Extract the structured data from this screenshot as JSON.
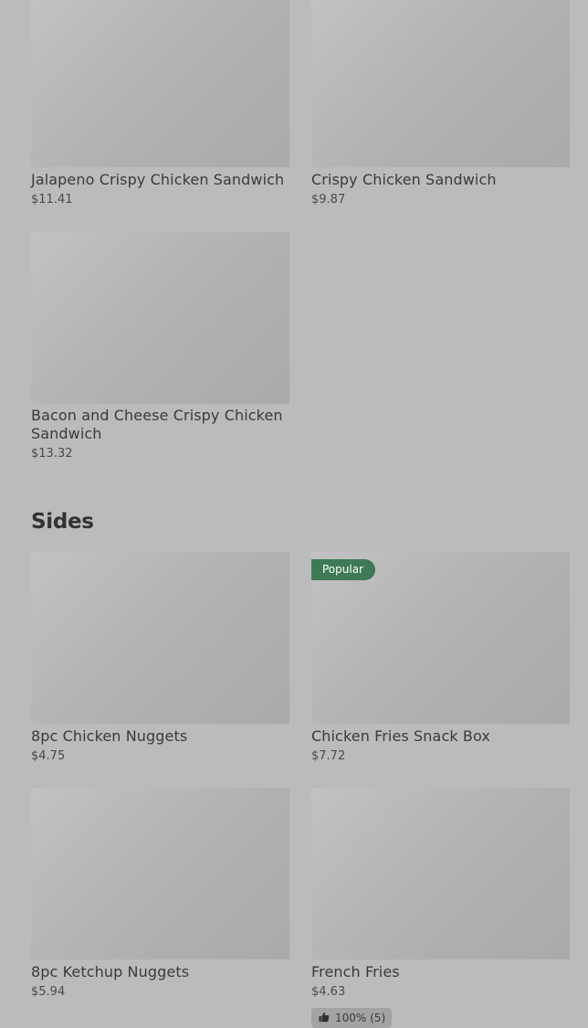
{
  "products": [
    {
      "name": "Jalapeno Crispy Chicken Sandwich",
      "price": "$11.41"
    },
    {
      "name": "Crispy Chicken Sandwich",
      "price": "$9.87"
    },
    {
      "name": "Bacon and Cheese Crispy Chicken Sandwich",
      "price": "$13.32"
    }
  ],
  "sides": {
    "title": "Sides",
    "items": [
      {
        "name": "8pc Chicken Nuggets",
        "price": "$4.75"
      },
      {
        "name": "Chicken Fries Snack Box",
        "price": "$7.72",
        "badge": "Popular"
      },
      {
        "name": "8pc Ketchup Nuggets",
        "price": "$5.94"
      },
      {
        "name": "French Fries",
        "price": "$4.63",
        "rating": "100% (5)"
      }
    ]
  },
  "colors": {
    "background": "#bbbbbb",
    "badge": "#3d7a55",
    "text": "#3a3a3a"
  },
  "icons": {
    "rating": "thumbs-up-icon"
  }
}
